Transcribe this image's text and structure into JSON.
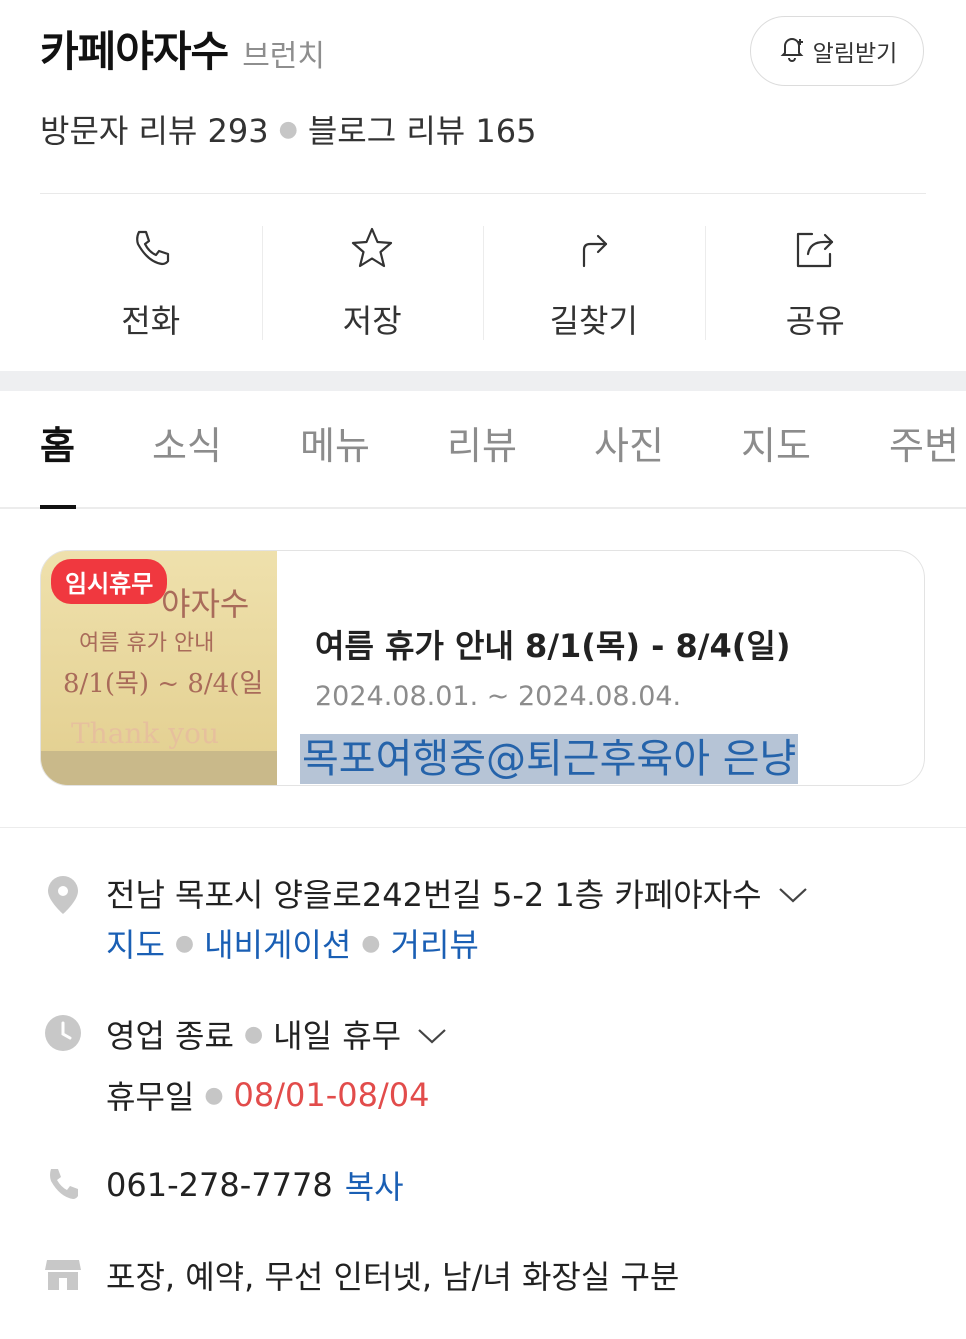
{
  "header": {
    "name": "카페야자수",
    "category": "브런치",
    "alarm_label": "알림받기",
    "visitor_reviews": "방문자 리뷰 293",
    "blog_reviews": "블로그 리뷰 165"
  },
  "actions": [
    {
      "label": "전화",
      "icon": "phone-icon"
    },
    {
      "label": "저장",
      "icon": "star-icon"
    },
    {
      "label": "길찾기",
      "icon": "directions-icon"
    },
    {
      "label": "공유",
      "icon": "share-icon"
    }
  ],
  "tabs": [
    "홈",
    "소식",
    "메뉴",
    "리뷰",
    "사진",
    "지도",
    "주변"
  ],
  "notice": {
    "badge": "임시휴무",
    "title": "여름 휴가 안내 8/1(목) - 8/4(일)",
    "date_range": "2024.08.01. ~ 2024.08.04.",
    "image_text": {
      "line1": "야자수",
      "line2": "여름 휴가 안내",
      "line3": "8/1(목) ~ 8/4(일",
      "line4": "Thank you"
    }
  },
  "watermark": "목포여행중@퇴근후육아 은냥",
  "info": {
    "address": "전남 목포시 양을로242번길 5-2 1층 카페야자수",
    "map_link": "지도",
    "navigation_link": "내비게이션",
    "street_view_link": "거리뷰",
    "hours_status": "영업 종료",
    "hours_next": "내일 휴무",
    "holiday_label": "휴무일",
    "holiday_dates": "08/01-08/04",
    "phone": "061-278-7778",
    "copy_label": "복사",
    "amenities": "포장, 예약, 무선 인터넷, 남/녀 화장실 구분"
  },
  "colors": {
    "link": "#1a5fb4",
    "badge": "#f0383f",
    "holiday": "#e24c4b",
    "icon_gray": "#c8c8c8"
  }
}
